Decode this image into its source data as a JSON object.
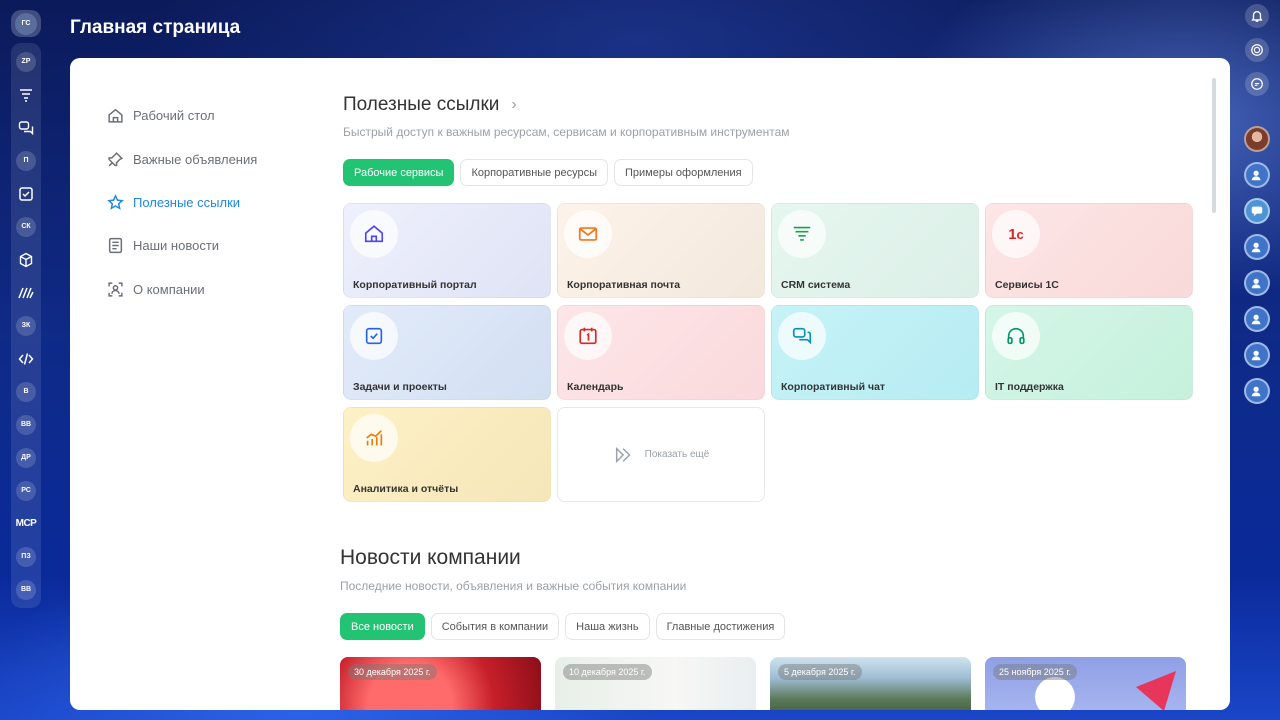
{
  "header": {
    "title": "Главная страница"
  },
  "left_rail": {
    "top_avatar": "ГС",
    "items": [
      {
        "type": "circle",
        "text": "ZP"
      },
      {
        "type": "icon",
        "icon": "funnel-icon"
      },
      {
        "type": "icon",
        "icon": "chat-icon"
      },
      {
        "type": "circle",
        "text": "П"
      },
      {
        "type": "icon",
        "icon": "checkbox-icon"
      },
      {
        "type": "circle",
        "text": "СК"
      },
      {
        "type": "icon",
        "icon": "cube-icon"
      },
      {
        "type": "icon",
        "icon": "stripes-logo-icon"
      },
      {
        "type": "circle",
        "text": "ЗК"
      },
      {
        "type": "icon",
        "icon": "code-icon"
      },
      {
        "type": "circle",
        "text": "В"
      },
      {
        "type": "circle",
        "text": "ВВ"
      },
      {
        "type": "circle",
        "text": "ДР"
      },
      {
        "type": "circle",
        "text": "РС"
      },
      {
        "type": "text",
        "text": "MCP"
      },
      {
        "type": "circle",
        "text": "ПЗ"
      },
      {
        "type": "circle",
        "text": "ВВ"
      }
    ]
  },
  "right_rail": {
    "icons": [
      "bell-icon",
      "target-icon",
      "search-chat-icon"
    ],
    "avatars": [
      "user-photo",
      "user-avatar",
      "chat-avatar",
      "user-avatar",
      "user-avatar",
      "user-avatar",
      "user-avatar",
      "user-avatar"
    ]
  },
  "nav": {
    "items": [
      {
        "label": "Рабочий стол",
        "icon": "home-icon",
        "active": false
      },
      {
        "label": "Важные объявления",
        "icon": "pin-icon",
        "active": false
      },
      {
        "label": "Полезные ссылки",
        "icon": "star-icon",
        "active": true
      },
      {
        "label": "Наши новости",
        "icon": "newspaper-icon",
        "active": false
      },
      {
        "label": "О компании",
        "icon": "company-icon",
        "active": false
      }
    ]
  },
  "links": {
    "title": "Полезные ссылки",
    "subtitle": "Быстрый доступ к важным ресурсам, сервисам и корпоративным инструментам",
    "tabs": [
      "Рабочие сервисы",
      "Корпоративные ресурсы",
      "Примеры оформления"
    ],
    "active_tab": 0,
    "cards": [
      {
        "label": "Корпоративный портал",
        "icon": "home-icon",
        "color": "#4f46e5",
        "bg": "#e8ebfb"
      },
      {
        "label": "Корпоративная почта",
        "icon": "mail-icon",
        "color": "#f97316",
        "bg": "#fdf0e6"
      },
      {
        "label": "CRM система",
        "icon": "funnel-icon",
        "color": "#16a34a",
        "bg": "#e3f6ee"
      },
      {
        "label": "Сервисы 1С",
        "icon": "1c-icon",
        "color": "#dc2626",
        "bg": "#fde3e3"
      },
      {
        "label": "Задачи и проекты",
        "icon": "checkbox-icon",
        "color": "#2563eb",
        "bg": "#dde8f8"
      },
      {
        "label": "Календарь",
        "icon": "calendar-icon",
        "color": "#dc2626",
        "bg": "#fde2e4"
      },
      {
        "label": "Корпоративный чат",
        "icon": "chat-icon",
        "color": "#0891b2",
        "bg": "#c8f3f7"
      },
      {
        "label": "IT поддержка",
        "icon": "headphones-icon",
        "color": "#059669",
        "bg": "#d2f6e6"
      },
      {
        "label": "Аналитика и отчёты",
        "icon": "chart-icon",
        "color": "#ea7a0c",
        "bg": "#fdf0c8"
      }
    ],
    "more_label": "Показать ещё"
  },
  "news": {
    "title": "Новости компании",
    "subtitle": "Последние новости, объявления и важные события компании",
    "tabs": [
      "Все новости",
      "События в компании",
      "Наша жизнь",
      "Главные достижения"
    ],
    "active_tab": 0,
    "items": [
      {
        "date": "30 декабря 2025 г."
      },
      {
        "date": "10 декабря 2025 г."
      },
      {
        "date": "5 декабря 2025 г."
      },
      {
        "date": "25 ноября 2025 г."
      }
    ]
  },
  "colors": {
    "accent_green": "#22c373",
    "active_nav": "#1e88e5"
  }
}
